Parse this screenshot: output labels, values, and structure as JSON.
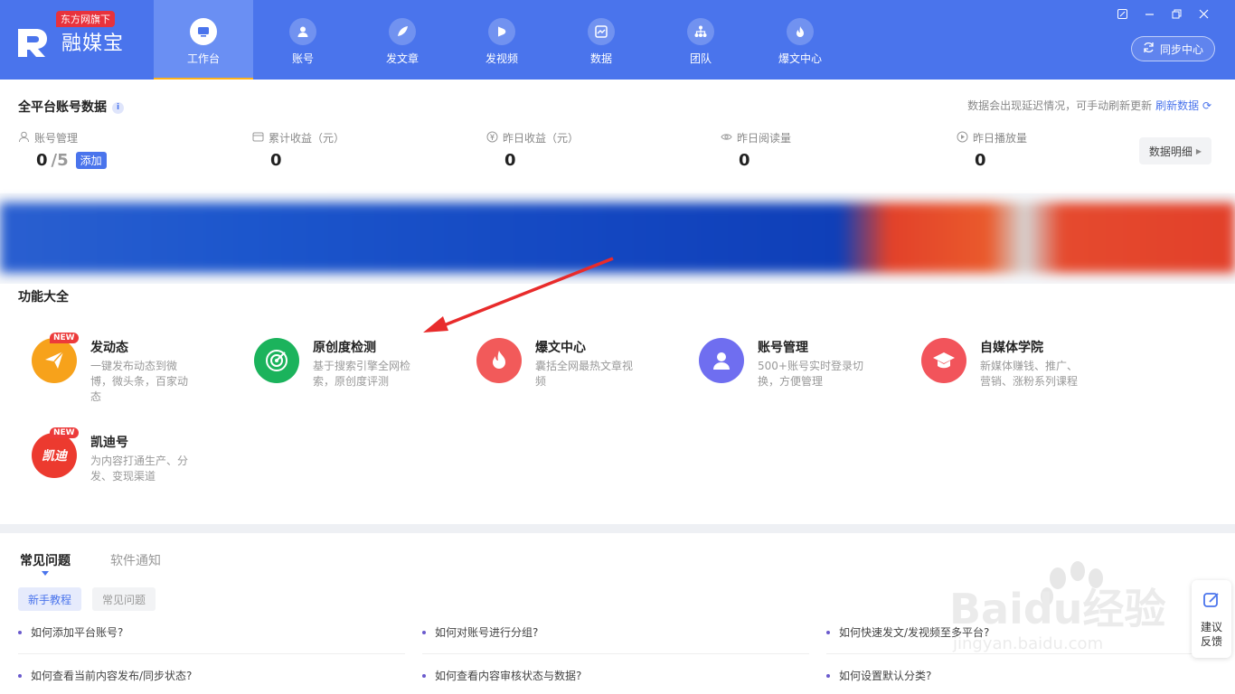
{
  "brand": {
    "tag": "东方网旗下",
    "name": "融媒宝"
  },
  "nav": [
    {
      "label": "工作台",
      "icon": "monitor-icon",
      "active": true
    },
    {
      "label": "账号",
      "icon": "user-icon"
    },
    {
      "label": "发文章",
      "icon": "feather-icon"
    },
    {
      "label": "发视频",
      "icon": "play-icon"
    },
    {
      "label": "数据",
      "icon": "chart-icon"
    },
    {
      "label": "团队",
      "icon": "team-icon"
    },
    {
      "label": "爆文中心",
      "icon": "flame-icon"
    }
  ],
  "sync_label": "同步中心",
  "stats": {
    "title": "全平台账号数据",
    "note": "数据会出现延迟情况，可手动刷新更新",
    "refresh_label": "刷新数据",
    "accounts": {
      "label": "账号管理",
      "value": "0",
      "max": "/5",
      "add": "添加"
    },
    "total_income": {
      "label": "累计收益（元）",
      "value": "0"
    },
    "yesterday_income": {
      "label": "昨日收益（元）",
      "value": "0"
    },
    "yesterday_reads": {
      "label": "昨日阅读量",
      "value": "0"
    },
    "yesterday_plays": {
      "label": "昨日播放量",
      "value": "0"
    },
    "detail_label": "数据明细"
  },
  "functions": {
    "title": "功能大全",
    "new_badge": "NEW",
    "items": [
      {
        "title": "发动态",
        "desc": "一键发布动态到微博，微头条，百家动态",
        "color": "#f7a21b"
      },
      {
        "title": "原创度检测",
        "desc": "基于搜索引擎全网检索，原创度评测",
        "color": "#1bb35c"
      },
      {
        "title": "爆文中心",
        "desc": "囊括全网最热文章视频",
        "color": "#f25a5a"
      },
      {
        "title": "账号管理",
        "desc": "500+账号实时登录切换，方便管理",
        "color": "#6f6ef0"
      },
      {
        "title": "自媒体学院",
        "desc": "新媒体赚钱、推广、营销、涨粉系列课程",
        "color": "#f2545b"
      },
      {
        "title": "凯迪号",
        "desc": "为内容打通生产、分发、变现渠道",
        "color": "#ec3a2f",
        "logo_text": "凯迪"
      }
    ]
  },
  "faq": {
    "tabs": [
      "常见问题",
      "软件通知"
    ],
    "pills": [
      "新手教程",
      "常见问题"
    ],
    "questions": [
      "如何添加平台账号?",
      "如何对账号进行分组?",
      "如何快速发文/发视频至多平台?",
      "如何查看当前内容发布/同步状态?",
      "如何查看内容审核状态与数据?",
      "如何设置默认分类?"
    ]
  },
  "feedback": {
    "line1": "建议",
    "line2": "反馈"
  },
  "watermark": {
    "text": "Baidu经验",
    "url": "jingyan.baidu.com"
  }
}
